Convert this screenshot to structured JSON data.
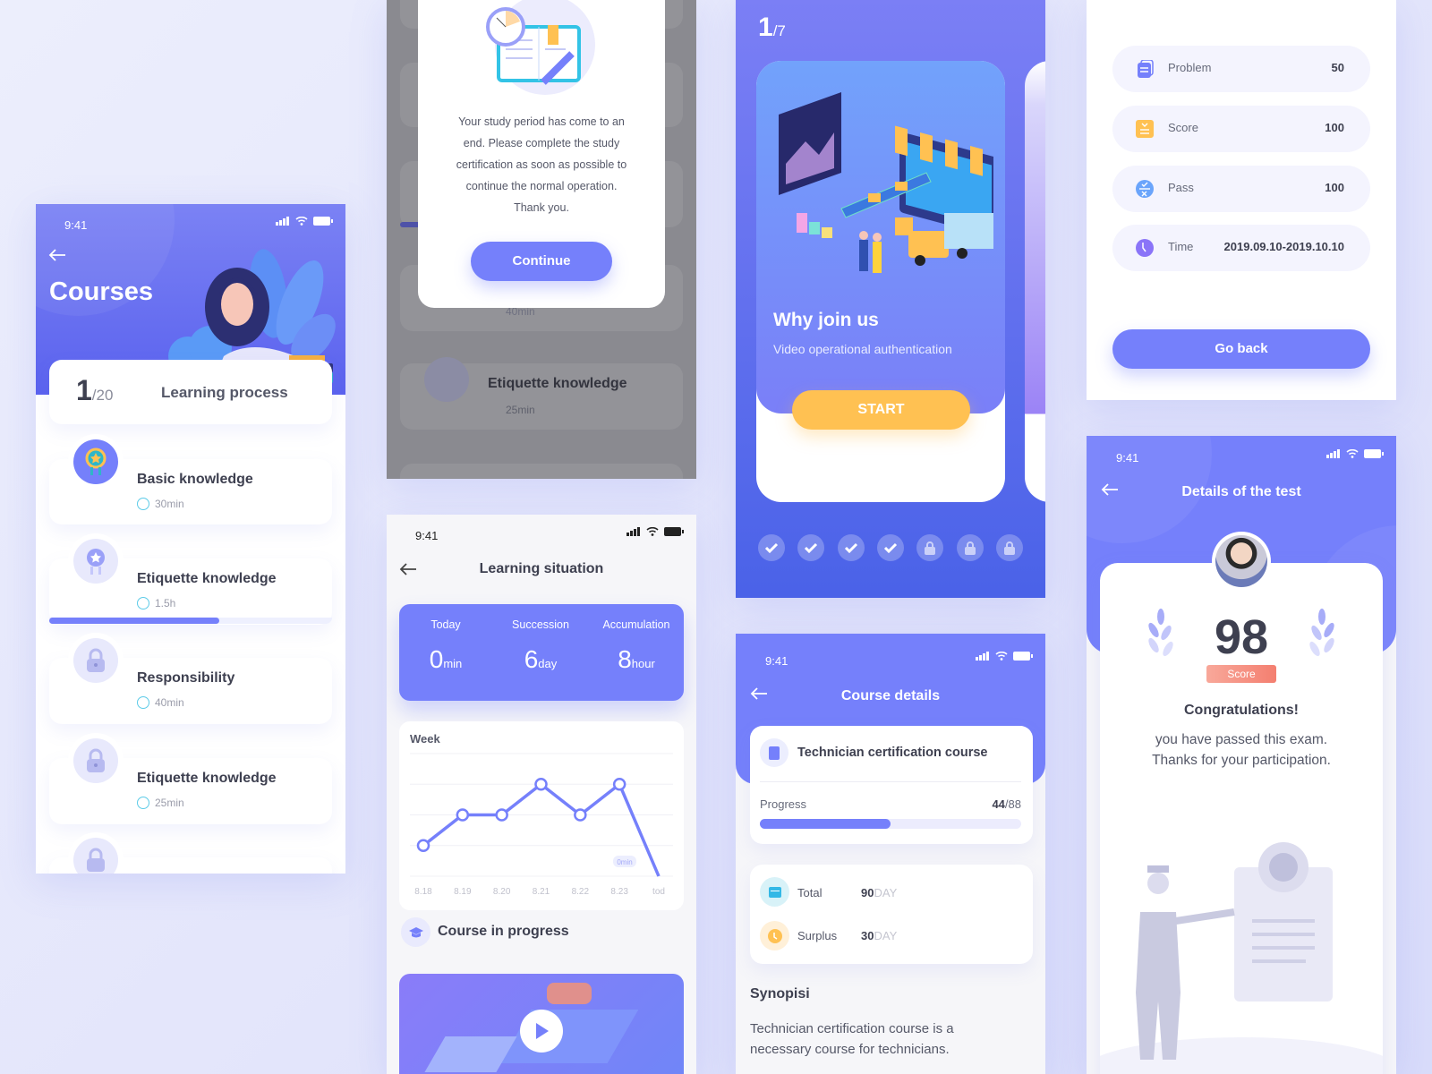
{
  "status_time": "9:41",
  "courses": {
    "title": "Courses",
    "progress_current": "1",
    "progress_total": "/20",
    "progress_label": "Learning process",
    "items": [
      {
        "title": "Basic knowledge",
        "duration": "30min",
        "state": "completed",
        "icon": "medal-icon"
      },
      {
        "title": "Etiquette knowledge",
        "duration": "1.5h",
        "state": "in-progress",
        "progress": 0.6,
        "icon": "medal-icon"
      },
      {
        "title": "Responsibility",
        "duration": "40min",
        "state": "locked",
        "icon": "lock-icon"
      },
      {
        "title": "Etiquette knowledge",
        "duration": "25min",
        "state": "locked",
        "icon": "lock-icon"
      }
    ]
  },
  "modal": {
    "message_lines": [
      "Your study period has come to an",
      "end. Please complete the study",
      "certification as soon as possible to",
      "continue the normal operation.",
      "Thank you."
    ],
    "continue_label": "Continue",
    "background_item": {
      "title": "Etiquette knowledge",
      "duration": "25min"
    },
    "background_partial_duration": "40min"
  },
  "learning": {
    "title": "Learning situation",
    "stats": [
      {
        "label": "Today",
        "value": "0",
        "unit": "min"
      },
      {
        "label": "Succession",
        "value": "6",
        "unit": "day"
      },
      {
        "label": "Accumulation",
        "value": "8",
        "unit": "hour"
      }
    ],
    "section_title": "Course in progress"
  },
  "chart_data": {
    "type": "line",
    "title": "Week",
    "categories": [
      "8.18",
      "8.19",
      "8.20",
      "8.21",
      "8.22",
      "8.23",
      "tod"
    ],
    "values": [
      1,
      2,
      2,
      3,
      2,
      3,
      0
    ],
    "ylim": [
      0,
      4
    ],
    "grid": true,
    "annotation": "0min",
    "color": "#7580fb"
  },
  "onboarding": {
    "page_current": "1",
    "page_total": "/7",
    "card_title": "Why join us",
    "card_subtitle": "Video operational authentication",
    "start_label": "START",
    "steps": [
      "done",
      "done",
      "done",
      "done",
      "locked",
      "locked",
      "locked"
    ]
  },
  "course_details": {
    "title": "Course details",
    "course_name": "Technician certification course",
    "progress_label": "Progress",
    "progress_done": "44",
    "progress_total": "/88",
    "progress_fraction": 0.5,
    "total_label": "Total",
    "total_value": "90",
    "total_unit": "DAY",
    "surplus_label": "Surplus",
    "surplus_value": "30",
    "surplus_unit": "DAY",
    "synopsis_title": "Synopisi",
    "synopsis_lines": [
      "Technician certification course is a",
      "necessary course for technicians."
    ]
  },
  "results": {
    "rows": [
      {
        "label": "Problem",
        "value": "50",
        "icon": "document-icon",
        "color": "#7580fb"
      },
      {
        "label": "Score",
        "value": "100",
        "icon": "checklist-icon",
        "color": "#ffc152"
      },
      {
        "label": "Pass",
        "value": "100",
        "icon": "pass-fail-icon",
        "color": "#6aa4fb"
      },
      {
        "label": "Time",
        "value": "2019.09.10-2019.10.10",
        "icon": "clock-icon",
        "color": "#8a74f8"
      }
    ],
    "go_back_label": "Go back"
  },
  "test_details": {
    "title": "Details of the test",
    "score": "98",
    "score_label": "Score",
    "congrats": "Congratulations!",
    "message_lines": [
      "you have passed this exam.",
      "Thanks for your participation."
    ]
  },
  "colors": {
    "primary": "#7580fb",
    "accent": "#ffc152",
    "teal": "#5ccbe8",
    "ribbon": "#f58a7c"
  }
}
